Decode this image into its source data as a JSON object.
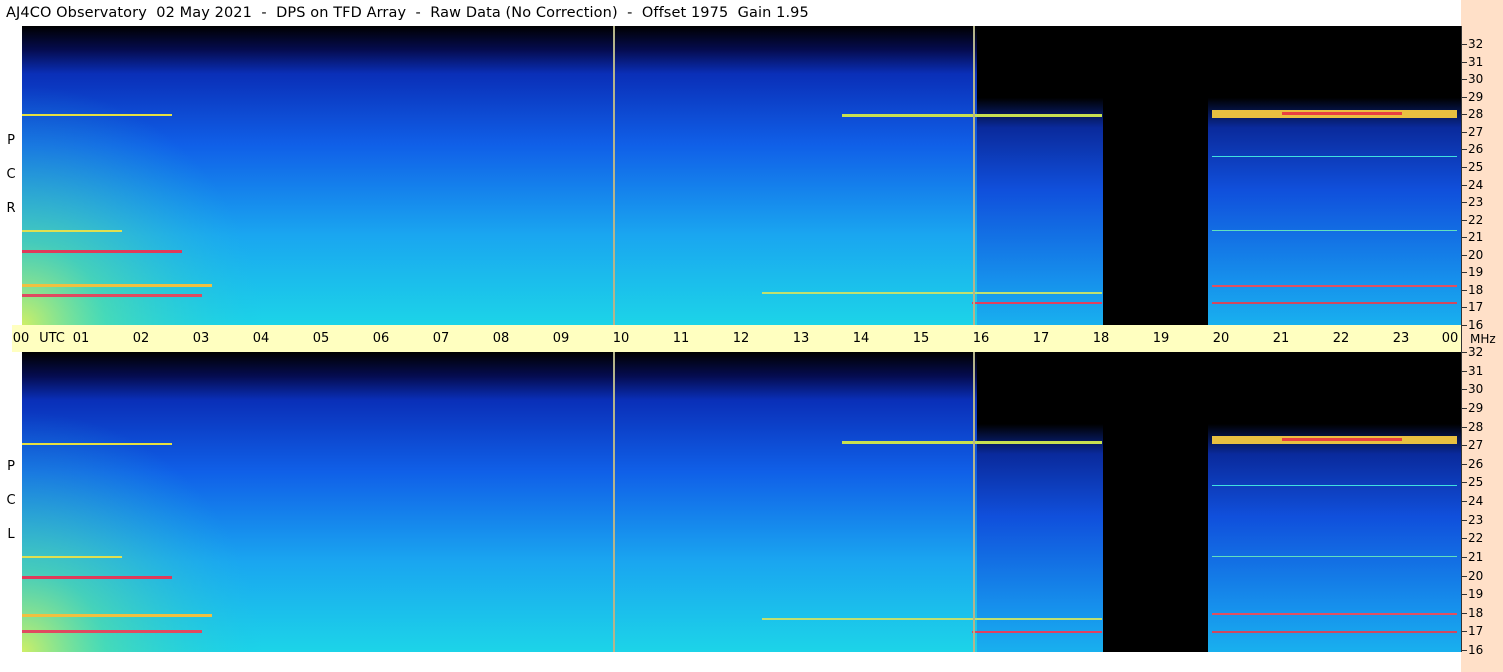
{
  "title": "AJ4CO Observatory  02 May 2021  -  DPS on TFD Array  -  Raw Data (No Correction)  -  Offset 1975  Gain 1.95",
  "panels": [
    {
      "letters": [
        "R",
        "C",
        "P"
      ]
    },
    {
      "letters": [
        "L",
        "C",
        "P"
      ]
    }
  ],
  "time_axis": {
    "labels": [
      "00",
      "01",
      "02",
      "03",
      "04",
      "05",
      "06",
      "07",
      "08",
      "09",
      "10",
      "11",
      "12",
      "13",
      "14",
      "15",
      "16",
      "17",
      "18",
      "19",
      "20",
      "21",
      "22",
      "23",
      "00"
    ],
    "utc_label": "UTC",
    "mhz_label": "MHz"
  },
  "freq_axis": {
    "labels": [
      "32",
      "31",
      "30",
      "29",
      "28",
      "27",
      "26",
      "25",
      "24",
      "23",
      "22",
      "21",
      "20",
      "19",
      "18",
      "17",
      "16"
    ]
  },
  "chart_data": {
    "type": "heatmap",
    "title": "AJ4CO Observatory  02 May 2021  -  DPS on TFD Array  -  Raw Data (No Correction)  -  Offset 1975  Gain 1.95",
    "x": {
      "unit": "UTC hour",
      "range": [
        0,
        24
      ],
      "ticks": [
        "00",
        "01",
        "02",
        "03",
        "04",
        "05",
        "06",
        "07",
        "08",
        "09",
        "10",
        "11",
        "12",
        "13",
        "14",
        "15",
        "16",
        "17",
        "18",
        "19",
        "20",
        "21",
        "22",
        "23",
        "00"
      ]
    },
    "y": {
      "unit": "MHz",
      "range": [
        16,
        32
      ],
      "ticks": [
        32,
        31,
        30,
        29,
        28,
        27,
        26,
        25,
        24,
        23,
        22,
        21,
        20,
        19,
        18,
        17,
        16
      ]
    },
    "panels": [
      "RCP",
      "LCP"
    ],
    "colormap": [
      "#000000",
      "#0a1a8c",
      "#1446e6",
      "#1e8cf0",
      "#14c8e6",
      "#50e68c",
      "#dcf050",
      "#f0a028",
      "#e02050"
    ],
    "data_gaps_utc": [
      [
        18.05,
        19.8
      ]
    ],
    "markers_utc": [
      9.85,
      15.85
    ]
  }
}
